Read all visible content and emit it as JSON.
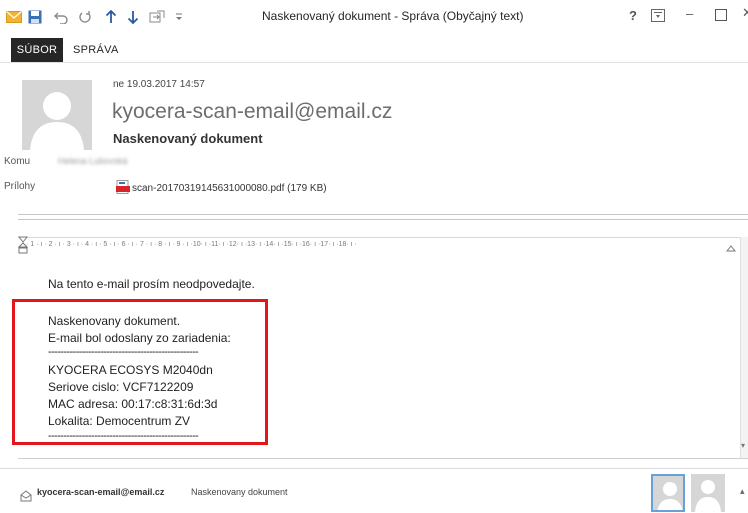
{
  "window": {
    "title": "Naskenovaný dokument - Správa (Obyčajný text)",
    "help": "?",
    "minimize": "–"
  },
  "ribbon": {
    "tab_file": "SÚBOR",
    "tab_message": "SPRÁVA"
  },
  "message": {
    "date": "ne 19.03.2017 14:57",
    "sender": "kyocera-scan-email@email.cz",
    "subject": "Naskenovaný dokument",
    "to_label": "Komu",
    "to_value": "Helena Lubovská",
    "attachments_label": "Prílohy",
    "attachment": "scan-20170319145631000080.pdf (179 KB)"
  },
  "ruler": {
    "text": "· 1 · ı · 2 · ı · 3 · ı · 4 · ı · 5 · ı · 6 · ı · 7 · ı · 8 · ı · 9 · ı ·10· ı ·11· ı ·12· ı ·13· ı ·14· ı ·15· ı ·16· ı ·17· ı ·18· ı ·"
  },
  "body": {
    "lines": [
      "Na tento e-mail prosím neodpovedajte.",
      "Naskenovany dokument.",
      "E-mail bol odoslany zo zariadenia:",
      "-------------------------------------------------",
      "KYOCERA ECOSYS M2040dn",
      "Seriove cislo: VCF7122209",
      "MAC adresa: 00:17:c8:31:6d:3d",
      "Lokalita: Democentrum ZV",
      "-------------------------------------------------"
    ]
  },
  "people_pane": {
    "sender": "kyocera-scan-email@email.cz",
    "subject": "Naskenovany dokument"
  },
  "colors": {
    "highlight": "#e4151b",
    "file_tab": "#262626",
    "save_icon": "#3b6fb6",
    "mail_icon": "#f2b233"
  }
}
